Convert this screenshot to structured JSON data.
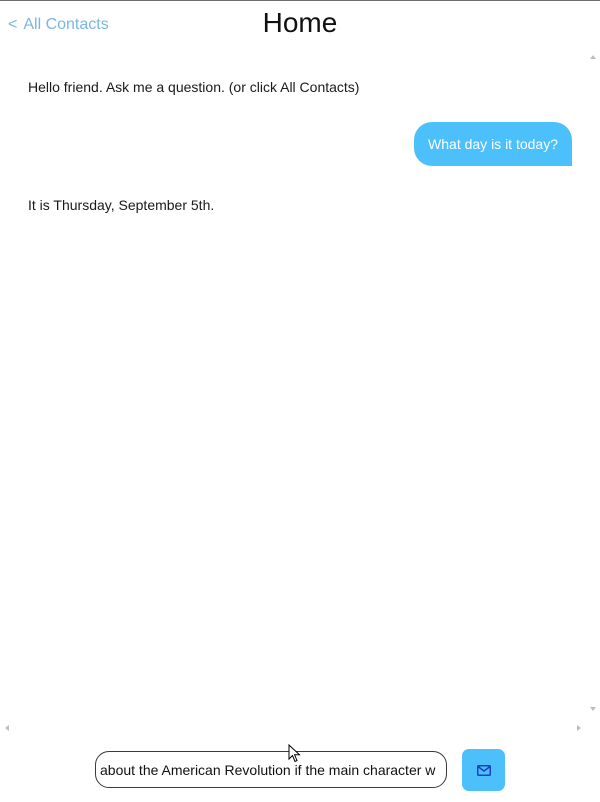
{
  "header": {
    "back_chevron": "<",
    "back_label": "All Contacts",
    "title": "Home"
  },
  "messages": [
    {
      "sender": "bot",
      "text": "Hello friend. Ask me a question. (or click All Contacts)"
    },
    {
      "sender": "user",
      "text": "What day is it today?"
    },
    {
      "sender": "bot",
      "text": "It is Thursday, September 5th."
    }
  ],
  "composer": {
    "input_value": "about the American Revolution if the main character w",
    "send_icon": "mail-icon"
  },
  "colors": {
    "accent": "#4cc0fb",
    "link": "#79b7e3",
    "send_icon": "#1d3fbf"
  }
}
